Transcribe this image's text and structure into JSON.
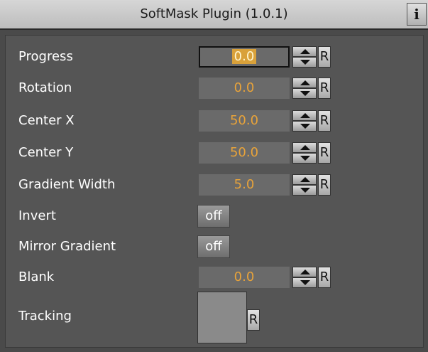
{
  "window": {
    "title": "SoftMask Plugin (1.0.1)",
    "info_label": "i"
  },
  "params": [
    {
      "label": "Progress",
      "value": "0.0",
      "reset": "R"
    },
    {
      "label": "Rotation",
      "value": "0.0",
      "reset": "R"
    },
    {
      "label": "Center X",
      "value": "50.0",
      "reset": "R"
    },
    {
      "label": "Center Y",
      "value": "50.0",
      "reset": "R"
    },
    {
      "label": "Gradient Width",
      "value": "5.0",
      "reset": "R"
    }
  ],
  "toggles": [
    {
      "label": "Invert",
      "value": "off"
    },
    {
      "label": "Mirror Gradient",
      "value": "off"
    }
  ],
  "blank": {
    "label": "Blank",
    "value": "0.0",
    "reset": "R"
  },
  "tracking": {
    "label": "Tracking",
    "reset": "R"
  },
  "colors": {
    "panel_bg": "#555555",
    "value_text": "#e8a33a",
    "field_bg": "#6a6a6a"
  }
}
